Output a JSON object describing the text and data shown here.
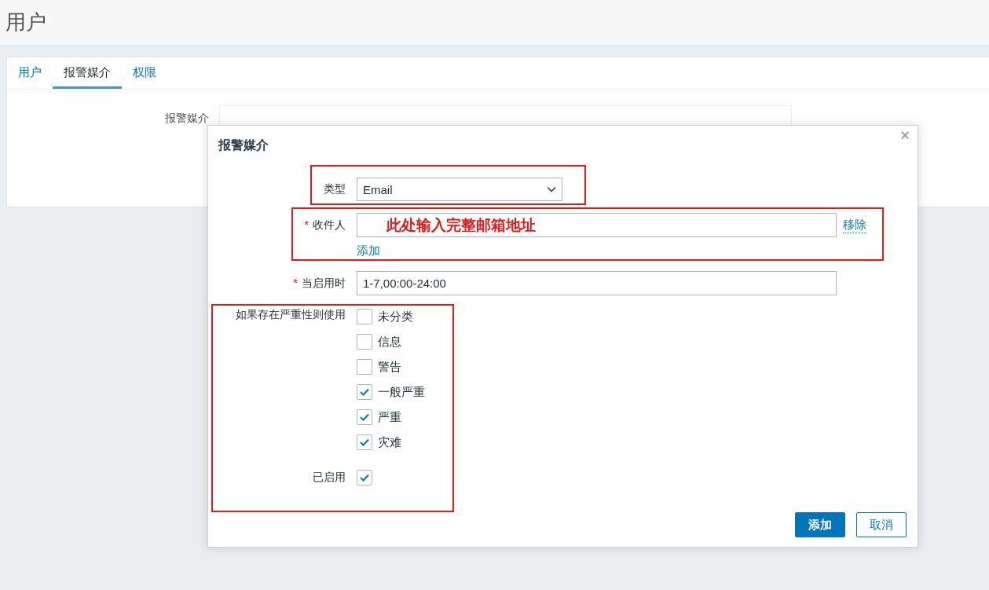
{
  "page": {
    "title": "用户"
  },
  "tabs": [
    {
      "label": "用户",
      "selected": false
    },
    {
      "label": "报警媒介",
      "selected": true
    },
    {
      "label": "权限",
      "selected": false
    }
  ],
  "media_form": {
    "label": "报警媒介"
  },
  "dialog": {
    "title": "报警媒介",
    "close": "×",
    "type": {
      "label": "类型",
      "value": "Email"
    },
    "recipient": {
      "label": "收件人",
      "required_mark": "*",
      "annotation_text": "此处输入完整邮箱地址",
      "remove": "移除",
      "add": "添加"
    },
    "when_active": {
      "label": "当启用时",
      "required_mark": "*",
      "value": "1-7,00:00-24:00"
    },
    "severity": {
      "label": "如果存在严重性则使用",
      "options": [
        {
          "label": "未分类",
          "checked": false
        },
        {
          "label": "信息",
          "checked": false
        },
        {
          "label": "警告",
          "checked": false
        },
        {
          "label": "一般严重",
          "checked": true
        },
        {
          "label": "严重",
          "checked": true
        },
        {
          "label": "灾难",
          "checked": true
        }
      ]
    },
    "enabled": {
      "label": "已启用",
      "checked": true
    },
    "buttons": [
      {
        "label": "添加",
        "kind": "primary"
      },
      {
        "label": "取消",
        "kind": "secondary"
      }
    ]
  }
}
